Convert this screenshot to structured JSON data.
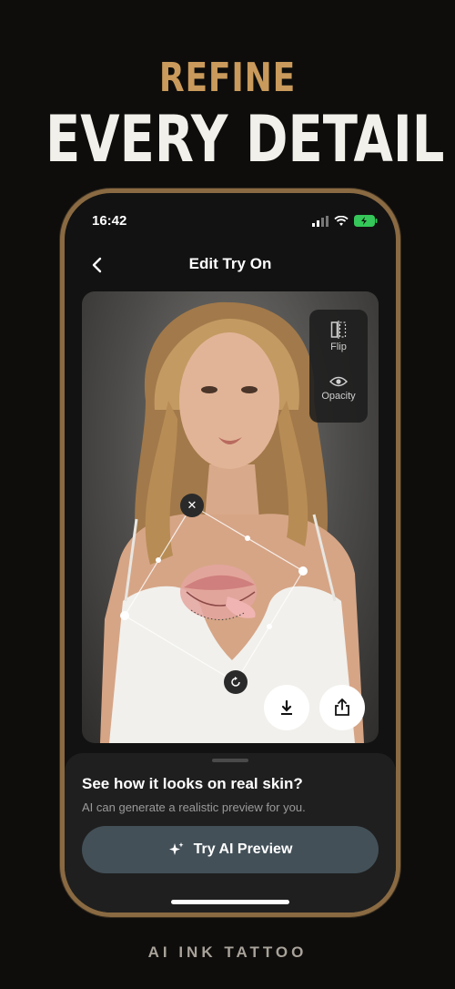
{
  "promo": {
    "headline_top": "REFINE",
    "headline_main": "EVERY DETAIL",
    "brand": "AI INK TATTOO"
  },
  "status_bar": {
    "time": "16:42"
  },
  "header": {
    "title": "Edit Try On"
  },
  "tools": [
    {
      "label": "Flip",
      "icon": "flip-icon"
    },
    {
      "label": "Opacity",
      "icon": "eye-icon"
    }
  ],
  "photo": {
    "description_icon": "portrait-photo"
  },
  "bottom_sheet": {
    "title": "See how it looks on real skin?",
    "subtitle": "AI can generate a realistic preview for you.",
    "cta_label": "Try AI Preview"
  },
  "colors": {
    "accent_gold": "#c99a5b",
    "cta_bg": "#435058",
    "battery_green": "#35c759"
  }
}
